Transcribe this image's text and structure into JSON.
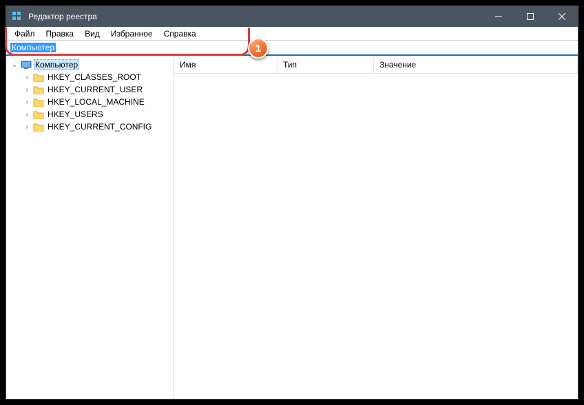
{
  "window": {
    "title": "Редактор реестра"
  },
  "menu": {
    "file": "Файл",
    "edit": "Правка",
    "view": "Вид",
    "favorites": "Избранное",
    "help": "Справка"
  },
  "addressbar": {
    "path": "Компьютер"
  },
  "callout": {
    "number": "1"
  },
  "tree": {
    "root": "Компьютер",
    "keys": [
      "HKEY_CLASSES_ROOT",
      "HKEY_CURRENT_USER",
      "HKEY_LOCAL_MACHINE",
      "HKEY_USERS",
      "HKEY_CURRENT_CONFIG"
    ]
  },
  "columns": {
    "name": "Имя",
    "type": "Тип",
    "value": "Значение"
  }
}
